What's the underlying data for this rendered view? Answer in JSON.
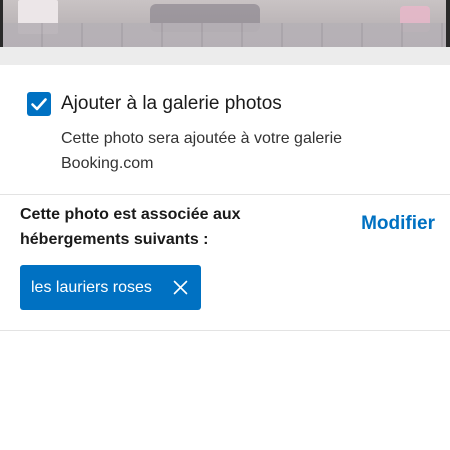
{
  "gallery": {
    "checked": true,
    "label": "Ajouter à la galerie photos",
    "description": "Cette photo sera ajoutée à votre galerie Booking.com"
  },
  "association": {
    "title": "Cette photo est associée aux hébergements suivants :",
    "modify_label": "Modifier",
    "properties": [
      {
        "label": "les lauriers roses"
      }
    ]
  },
  "colors": {
    "accent": "#0071c2",
    "divider": "#e3e3e3",
    "text": "#1a1a1a"
  },
  "icons": {
    "checkbox": "check-icon",
    "chip_remove": "close-icon"
  }
}
